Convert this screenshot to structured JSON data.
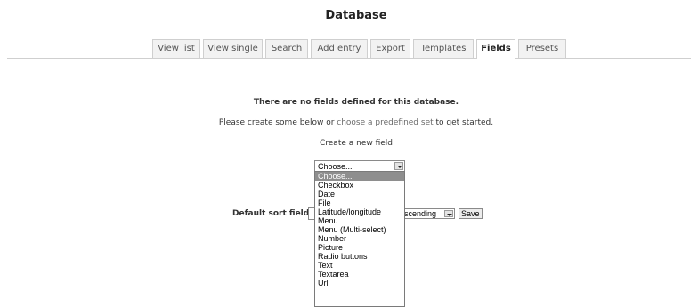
{
  "page": {
    "title": "Database"
  },
  "tabs": [
    {
      "label": "View list"
    },
    {
      "label": "View single"
    },
    {
      "label": "Search"
    },
    {
      "label": "Add entry"
    },
    {
      "label": "Export"
    },
    {
      "label": "Templates"
    },
    {
      "label": "Fields",
      "active": true
    },
    {
      "label": "Presets"
    }
  ],
  "messages": {
    "no_fields": "There are no fields defined for this database.",
    "create_prefix": "Please create some below or ",
    "create_link": "choose a predefined set",
    "create_suffix": " to get started.",
    "create_heading": "Create a new field"
  },
  "field_type_select": {
    "value": "Choose...",
    "options": [
      "Choose...",
      "Checkbox",
      "Date",
      "File",
      "Latitude/longitude",
      "Menu",
      "Menu (Multi-select)",
      "Number",
      "Picture",
      "Radio buttons",
      "Text",
      "Textarea",
      "Url"
    ],
    "highlighted": "Choose..."
  },
  "sort": {
    "label": "Default sort field",
    "order_value": "scending",
    "save_label": "Save"
  }
}
